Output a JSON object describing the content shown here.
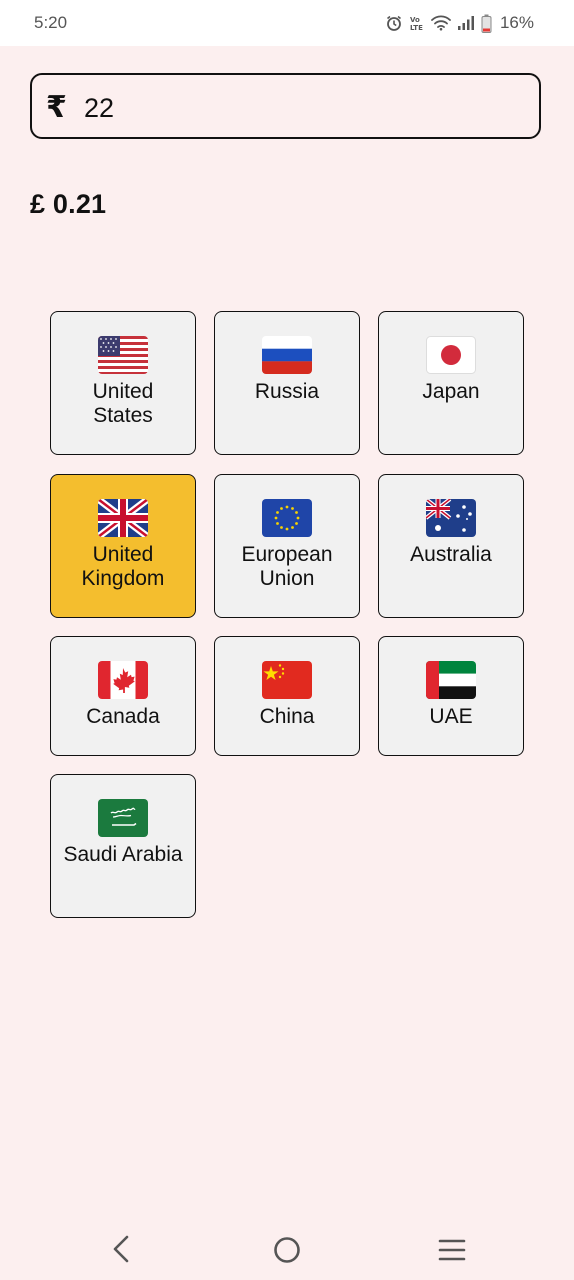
{
  "status_bar": {
    "time": "5:20",
    "battery_percent": "16%",
    "icons": [
      "alarm-icon",
      "volte-icon",
      "wifi-icon",
      "signal-icon",
      "battery-icon"
    ]
  },
  "converter": {
    "currency_symbol": "₹",
    "amount_value": "22",
    "result": "£ 0.21"
  },
  "countries": [
    {
      "name": "United States",
      "flag": "us-flag-icon",
      "selected": false
    },
    {
      "name": "Russia",
      "flag": "russia-flag-icon",
      "selected": false
    },
    {
      "name": "Japan",
      "flag": "japan-flag-icon",
      "selected": false
    },
    {
      "name": "United Kingdom",
      "flag": "uk-flag-icon",
      "selected": true
    },
    {
      "name": "European Union",
      "flag": "eu-flag-icon",
      "selected": false
    },
    {
      "name": "Australia",
      "flag": "australia-flag-icon",
      "selected": false
    },
    {
      "name": "Canada",
      "flag": "canada-flag-icon",
      "selected": false
    },
    {
      "name": "China",
      "flag": "china-flag-icon",
      "selected": false
    },
    {
      "name": "UAE",
      "flag": "uae-flag-icon",
      "selected": false
    },
    {
      "name": "Saudi Arabia",
      "flag": "saudi-flag-icon",
      "selected": false
    }
  ],
  "colors": {
    "background": "#FCEFEF",
    "tile": "#F1F1F1",
    "selected_tile": "#F4BE2E"
  },
  "nav_bar": {
    "icons": [
      "back-icon",
      "home-icon",
      "recents-icon"
    ]
  }
}
